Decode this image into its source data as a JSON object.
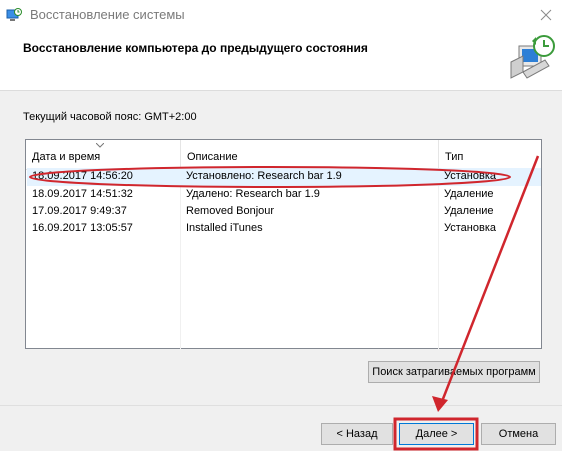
{
  "window": {
    "title": "Восстановление системы",
    "icons": {
      "app": "system-restore-icon",
      "close": "close-icon",
      "header": "restore-computer-icon"
    }
  },
  "header": {
    "title": "Восстановление компьютера до предыдущего состояния"
  },
  "timezone": "Текущий часовой пояс: GMT+2:00",
  "table": {
    "columns": [
      "Дата и время",
      "Описание",
      "Тип"
    ],
    "rows": [
      {
        "date": "18.09.2017 14:56:20",
        "description": "Установлено: Research bar 1.9",
        "type": "Установка"
      },
      {
        "date": "18.09.2017 14:51:32",
        "description": "Удалено: Research bar 1.9",
        "type": "Удаление"
      },
      {
        "date": "17.09.2017 9:49:37",
        "description": "Removed Bonjour",
        "type": "Удаление"
      },
      {
        "date": "16.09.2017 13:05:57",
        "description": "Installed iTunes",
        "type": "Установка"
      }
    ],
    "selected_row": 0
  },
  "buttons": {
    "scan": "Поиск затрагиваемых программ",
    "back": "< Назад",
    "next": "Далее >",
    "cancel": "Отмена"
  },
  "colors": {
    "annotation": "#d0262d",
    "selection": "#e5f3ff",
    "default_button_border": "#0078d7"
  }
}
